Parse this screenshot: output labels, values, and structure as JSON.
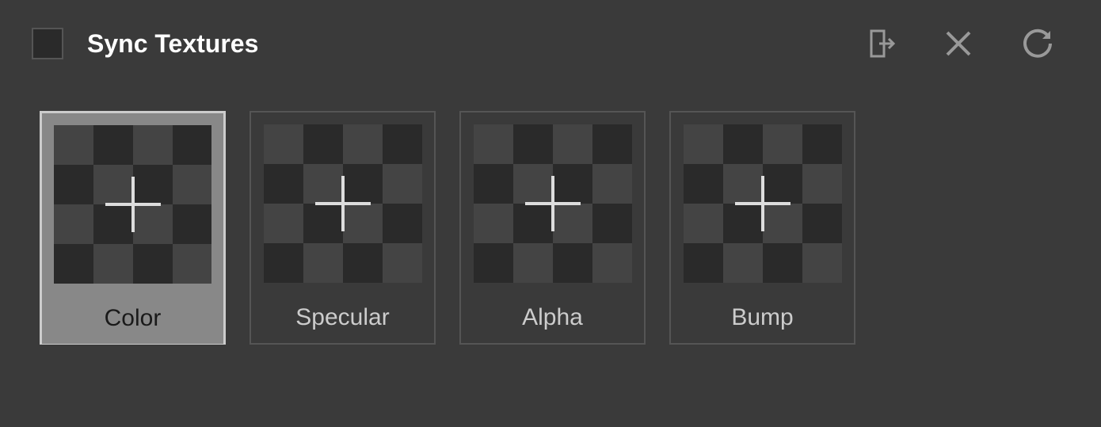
{
  "header": {
    "title": "Sync Textures",
    "sync_checked": false
  },
  "actions": {
    "export": "export",
    "close": "close",
    "refresh": "refresh"
  },
  "texture_slots": [
    {
      "label": "Color",
      "selected": true
    },
    {
      "label": "Specular",
      "selected": false
    },
    {
      "label": "Alpha",
      "selected": false
    },
    {
      "label": "Bump",
      "selected": false
    }
  ]
}
